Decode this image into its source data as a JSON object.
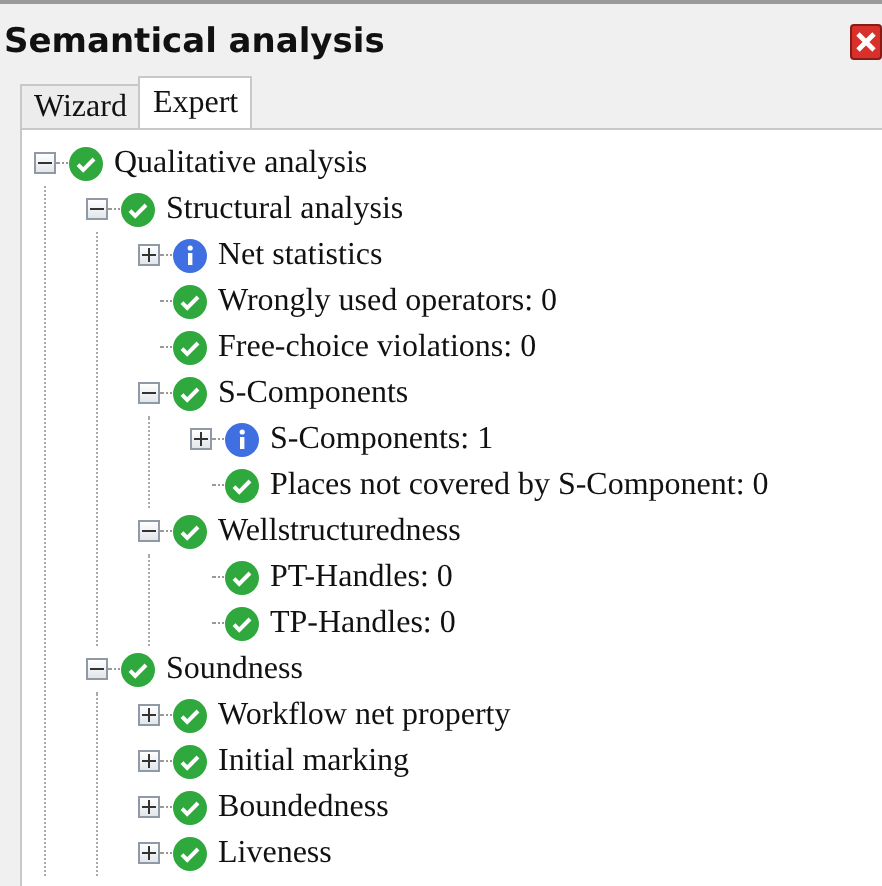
{
  "window": {
    "title": "Semantical analysis"
  },
  "tabs": [
    {
      "label": "Wizard",
      "selected": false
    },
    {
      "label": "Expert",
      "selected": true
    }
  ],
  "tree": [
    {
      "label": "Qualitative analysis",
      "kind": "check",
      "expanded": true,
      "children": [
        {
          "label": "Structural analysis",
          "kind": "check",
          "expanded": true,
          "children": [
            {
              "label": "Net statistics",
              "kind": "info",
              "expanded": false
            },
            {
              "label": "Wrongly used operators: 0",
              "kind": "check"
            },
            {
              "label": "Free-choice violations: 0",
              "kind": "check"
            },
            {
              "label": "S-Components",
              "kind": "check",
              "expanded": true,
              "children": [
                {
                  "label": "S-Components: 1",
                  "kind": "info",
                  "expanded": false
                },
                {
                  "label": "Places not covered by S-Component: 0",
                  "kind": "check"
                }
              ]
            },
            {
              "label": "Wellstructuredness",
              "kind": "check",
              "expanded": true,
              "children": [
                {
                  "label": "PT-Handles: 0",
                  "kind": "check"
                },
                {
                  "label": "TP-Handles: 0",
                  "kind": "check"
                }
              ]
            }
          ]
        },
        {
          "label": "Soundness",
          "kind": "check",
          "expanded": true,
          "children": [
            {
              "label": "Workflow net property",
              "kind": "check",
              "expanded": false
            },
            {
              "label": "Initial marking",
              "kind": "check",
              "expanded": false
            },
            {
              "label": "Boundedness",
              "kind": "check",
              "expanded": false
            },
            {
              "label": "Liveness",
              "kind": "check",
              "expanded": false
            }
          ]
        }
      ]
    }
  ]
}
